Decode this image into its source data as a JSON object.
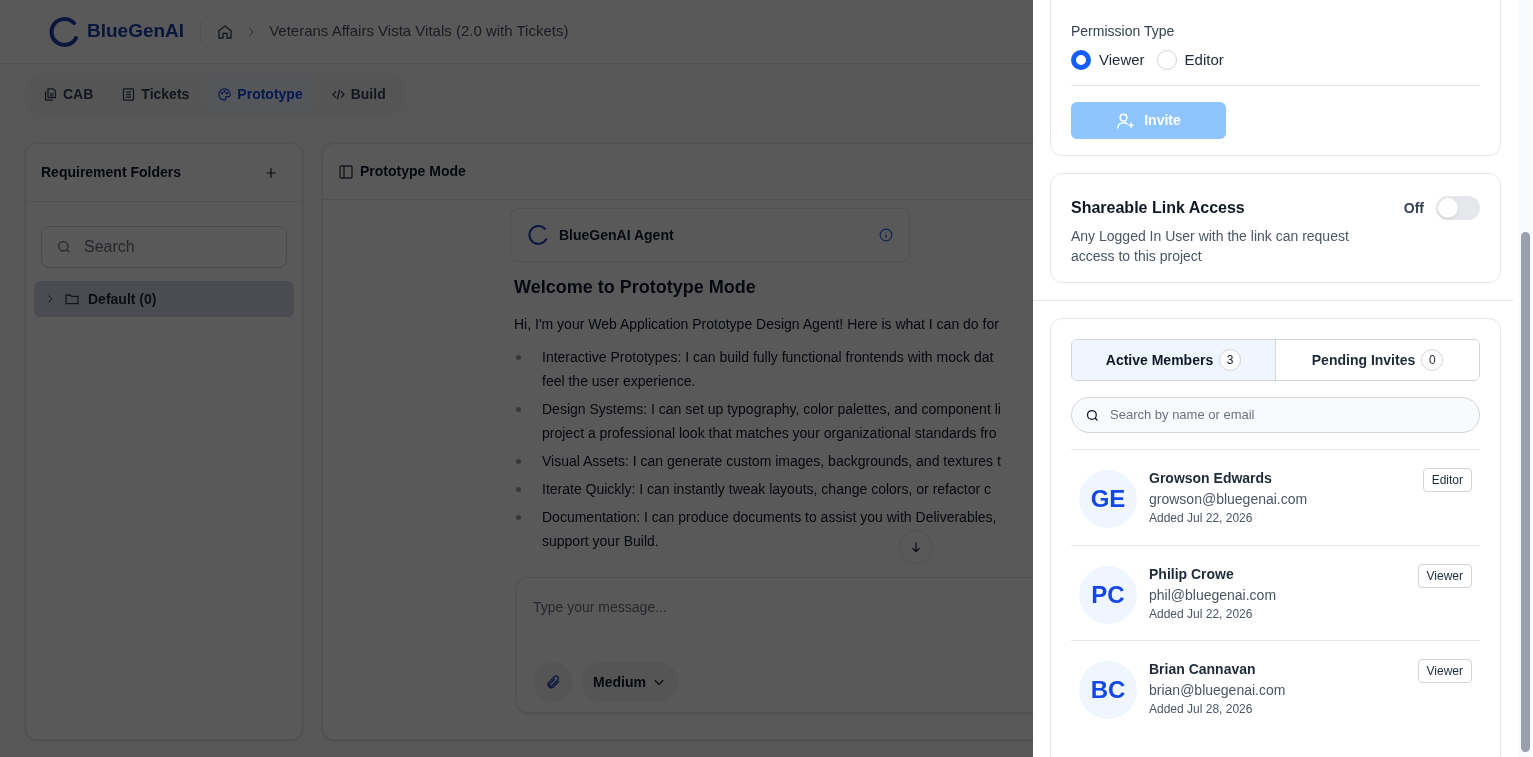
{
  "header": {
    "brand": "BlueGenAI",
    "breadcrumb": "Veterans Affairs Vista Vitals (2.0 with Tickets)"
  },
  "tabs": [
    {
      "label": "CAB",
      "selected": false
    },
    {
      "label": "Tickets",
      "selected": false
    },
    {
      "label": "Prototype",
      "selected": true
    },
    {
      "label": "Build",
      "selected": false
    }
  ],
  "folders_panel": {
    "title": "Requirement Folders",
    "search": {
      "placeholder": "Search"
    },
    "folders": [
      {
        "label": "Default (0)",
        "expanded": false,
        "selected": true
      }
    ]
  },
  "prototype_panel": {
    "title": "Prototype Mode",
    "agent": "BlueGenAI Agent",
    "heading": "Welcome to Prototype Mode",
    "intro": "Hi, I'm your Web Application Prototype Design Agent! Here is what I can do for",
    "bullets": [
      {
        "lines": [
          "Interactive Prototypes: I can build fully functional frontends with mock dat",
          "feel the user experience."
        ]
      },
      {
        "lines": [
          "Design Systems: I can set up typography, color palettes, and component li",
          "project a professional look that matches your organizational standards fro"
        ]
      },
      {
        "lines": [
          "Visual Assets: I can generate custom images, backgrounds, and textures t"
        ]
      },
      {
        "lines": [
          "Iterate Quickly: I can instantly tweak layouts, change colors, or refactor c"
        ]
      },
      {
        "lines": [
          "Documentation: I can produce documents to assist you with Deliverables,",
          "support your Build."
        ]
      }
    ],
    "message": {
      "placeholder": "Type your message..."
    },
    "effort": "Medium"
  },
  "share_drawer": {
    "permission": {
      "label": "Permission Type",
      "options": [
        {
          "label": "Viewer",
          "selected": true
        },
        {
          "label": "Editor",
          "selected": false
        }
      ]
    },
    "invite": {
      "label": "Invite",
      "disabled": true
    },
    "link_access": {
      "title": "Shareable Link Access",
      "description": "Any Logged In User with the link can request access to this project",
      "state_label": "Off",
      "on": false
    },
    "member_tabs": [
      {
        "label": "Active Members",
        "count": "3",
        "selected": true
      },
      {
        "label": "Pending Invites",
        "count": "0",
        "selected": false
      }
    ],
    "member_search": {
      "placeholder": "Search by name or email"
    },
    "members": [
      {
        "initials": "GE",
        "name": "Growson Edwards",
        "email": "growson@bluegenai.com",
        "added": "Added Jul 22, 2026",
        "role": "Editor"
      },
      {
        "initials": "PC",
        "name": "Philip Crowe",
        "email": "phil@bluegenai.com",
        "added": "Added Jul 22, 2026",
        "role": "Viewer"
      },
      {
        "initials": "BC",
        "name": "Brian Cannavan",
        "email": "brian@bluegenai.com",
        "added": "Added Jul 28, 2026",
        "role": "Viewer"
      }
    ]
  }
}
